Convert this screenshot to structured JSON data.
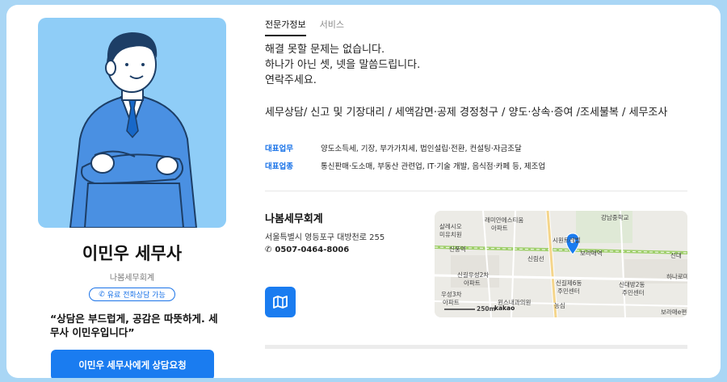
{
  "profile": {
    "name": "이민우 세무사",
    "firm": "나봄세무회계",
    "badge": "유료 전화상담 가능",
    "quote": "“상담은 부드럽게, 공감은 따뜻하게. 세무사 이민우입니다”",
    "cta": "이민우 세무사에게 상담요청"
  },
  "tabs": [
    {
      "label": "전문가정보",
      "active": true
    },
    {
      "label": "서비스",
      "active": false
    }
  ],
  "intro": [
    "해결 못할 문제는 없습니다.",
    "하나가 아닌 셋, 넷을 말씀드립니다.",
    "연락주세요."
  ],
  "services": "세무상담/ 신고 및 기장대리 / 세액감면·공제 경정청구 / 양도·상속·증여 /조세불복 / 세무조사",
  "details": [
    {
      "key": "대표업무",
      "value": "양도소득세, 기장, 부가가치세, 법인설립·전환, 컨설팅·자금조달"
    },
    {
      "key": "대표업종",
      "value": "통신판매·도소매, 부동산 관련업, IT·기술 개발, 음식점·카페 등, 제조업"
    }
  ],
  "office": {
    "name": "나봄세무회계",
    "address": "서울특별시 영등포구 대방천로 255",
    "phone": "0507-0464-8006"
  },
  "map": {
    "labels": [
      "살레시오",
      "미유치원",
      "래미안에스티움",
      "아파트",
      "강남중학교",
      "신풍역",
      "보라매역",
      "신림선",
      "신대",
      "시원트레벨",
      "신길우성2차",
      "아파트",
      "신길제6동",
      "주민센터",
      "신대방2동",
      "주민센터",
      "하나로마트",
      "우성3차",
      "아파트",
      "윈스내과의원",
      "농심",
      "보라매e편",
      "250m",
      "kakao"
    ]
  },
  "icons": [
    "phone-icon",
    "map-icon",
    "location-pin-icon"
  ],
  "colors": {
    "accent": "#1a7cf0",
    "portrait_bg": "#8fcdf7",
    "frame": "#a9d6f5"
  }
}
